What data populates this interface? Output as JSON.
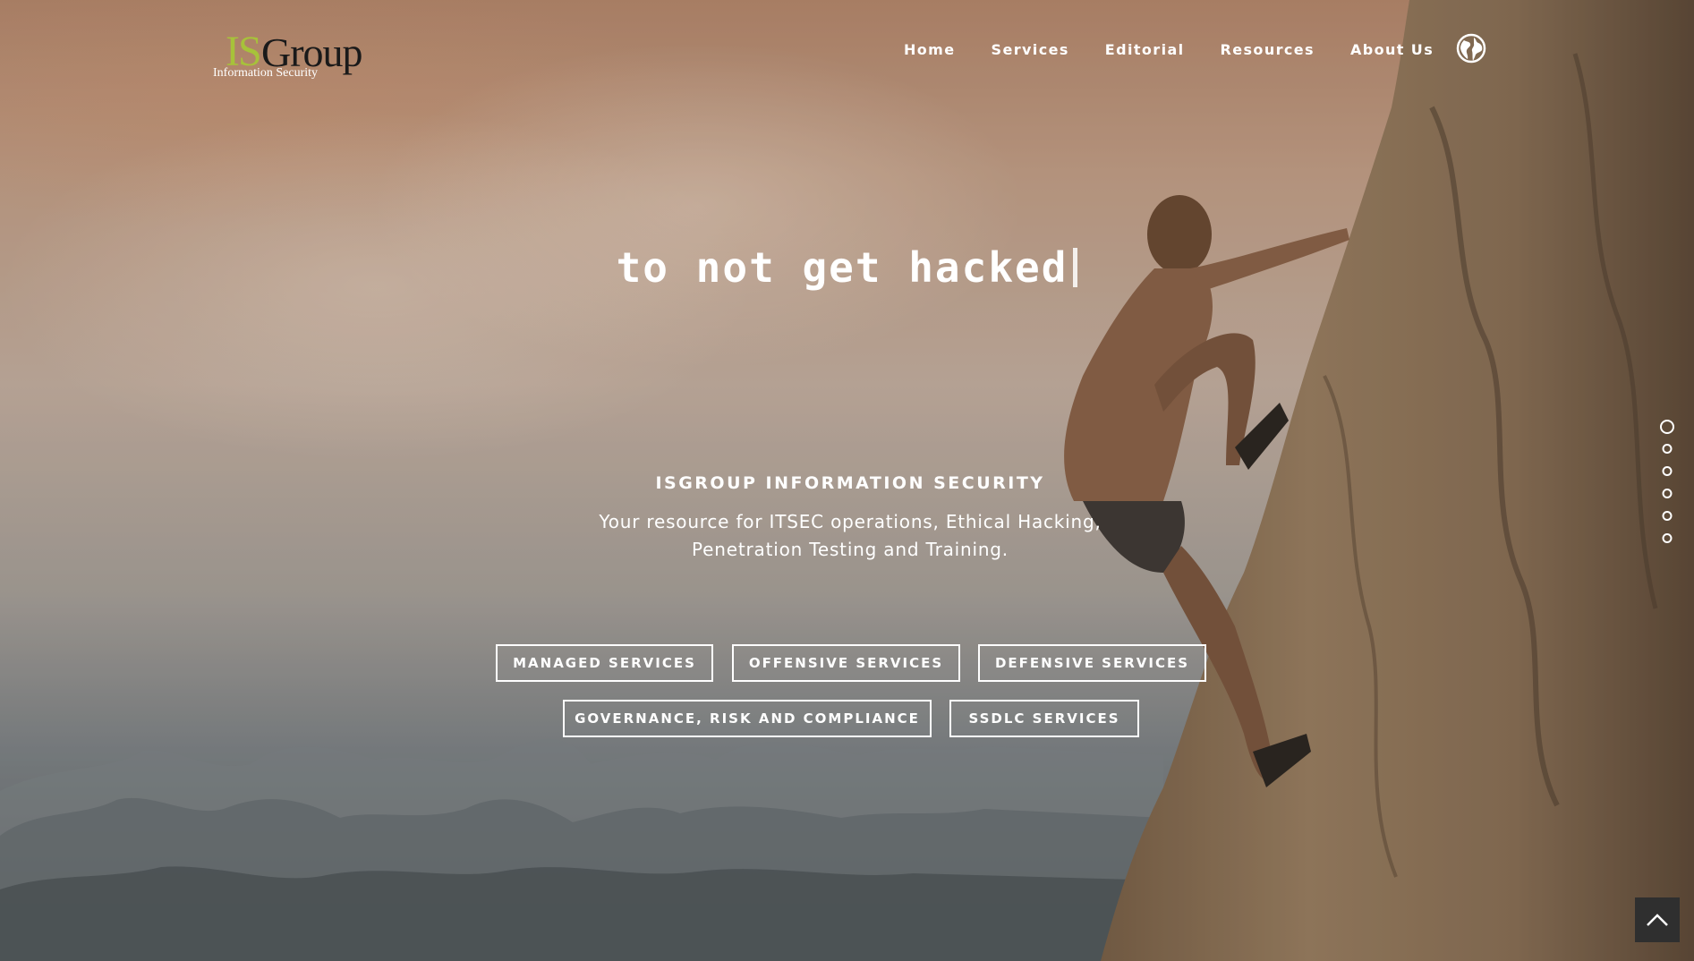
{
  "logo": {
    "mark_is": "IS",
    "mark_group": "Group",
    "subtitle": "Information Security"
  },
  "nav": {
    "items": [
      {
        "label": "Home"
      },
      {
        "label": "Services"
      },
      {
        "label": "Editorial"
      },
      {
        "label": "Resources"
      },
      {
        "label": "About Us"
      }
    ],
    "language_icon": "globe-icon"
  },
  "hero": {
    "typed_text": "to not get hacked",
    "eyebrow": "ISGROUP INFORMATION SECURITY",
    "tagline_line1": "Your resource for ITSEC operations, Ethical Hacking,",
    "tagline_line2": "Penetration Testing and Training."
  },
  "buttons": {
    "managed": "MANAGED SERVICES",
    "offensive": "OFFENSIVE SERVICES",
    "defensive": "DEFENSIVE SERVICES",
    "grc": "GOVERNANCE, RISK AND COMPLIANCE",
    "ssdlc": "SSDLC SERVICES"
  },
  "section_dots": {
    "count": 6,
    "active_index": 0
  },
  "back_to_top_icon": "chevron-up-icon",
  "colors": {
    "accent_green": "#a7c23a",
    "logo_dark": "#1a1a1a",
    "overlay_button": "#2f2f2f"
  }
}
